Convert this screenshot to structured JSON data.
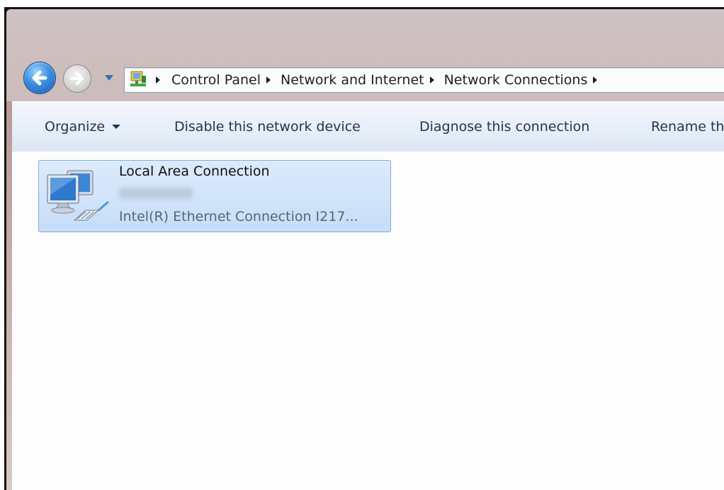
{
  "nav": {
    "back_icon": "back-arrow-icon",
    "forward_icon": "forward-arrow-icon",
    "history_icon": "chevron-down-icon",
    "location_icon": "network-connections-icon"
  },
  "breadcrumb": {
    "items": [
      "Control Panel",
      "Network and Internet",
      "Network Connections"
    ]
  },
  "command_bar": {
    "organize": "Organize",
    "disable": "Disable this network device",
    "diagnose": "Diagnose this connection",
    "rename": "Rename th"
  },
  "connection": {
    "name": "Local Area Connection",
    "device": "Intel(R) Ethernet Connection I217...",
    "icon": "network-adapter-icon"
  },
  "colors": {
    "accent": "#3b8de0",
    "selection": "#c6ddf7",
    "selection_border": "#84acdd"
  }
}
